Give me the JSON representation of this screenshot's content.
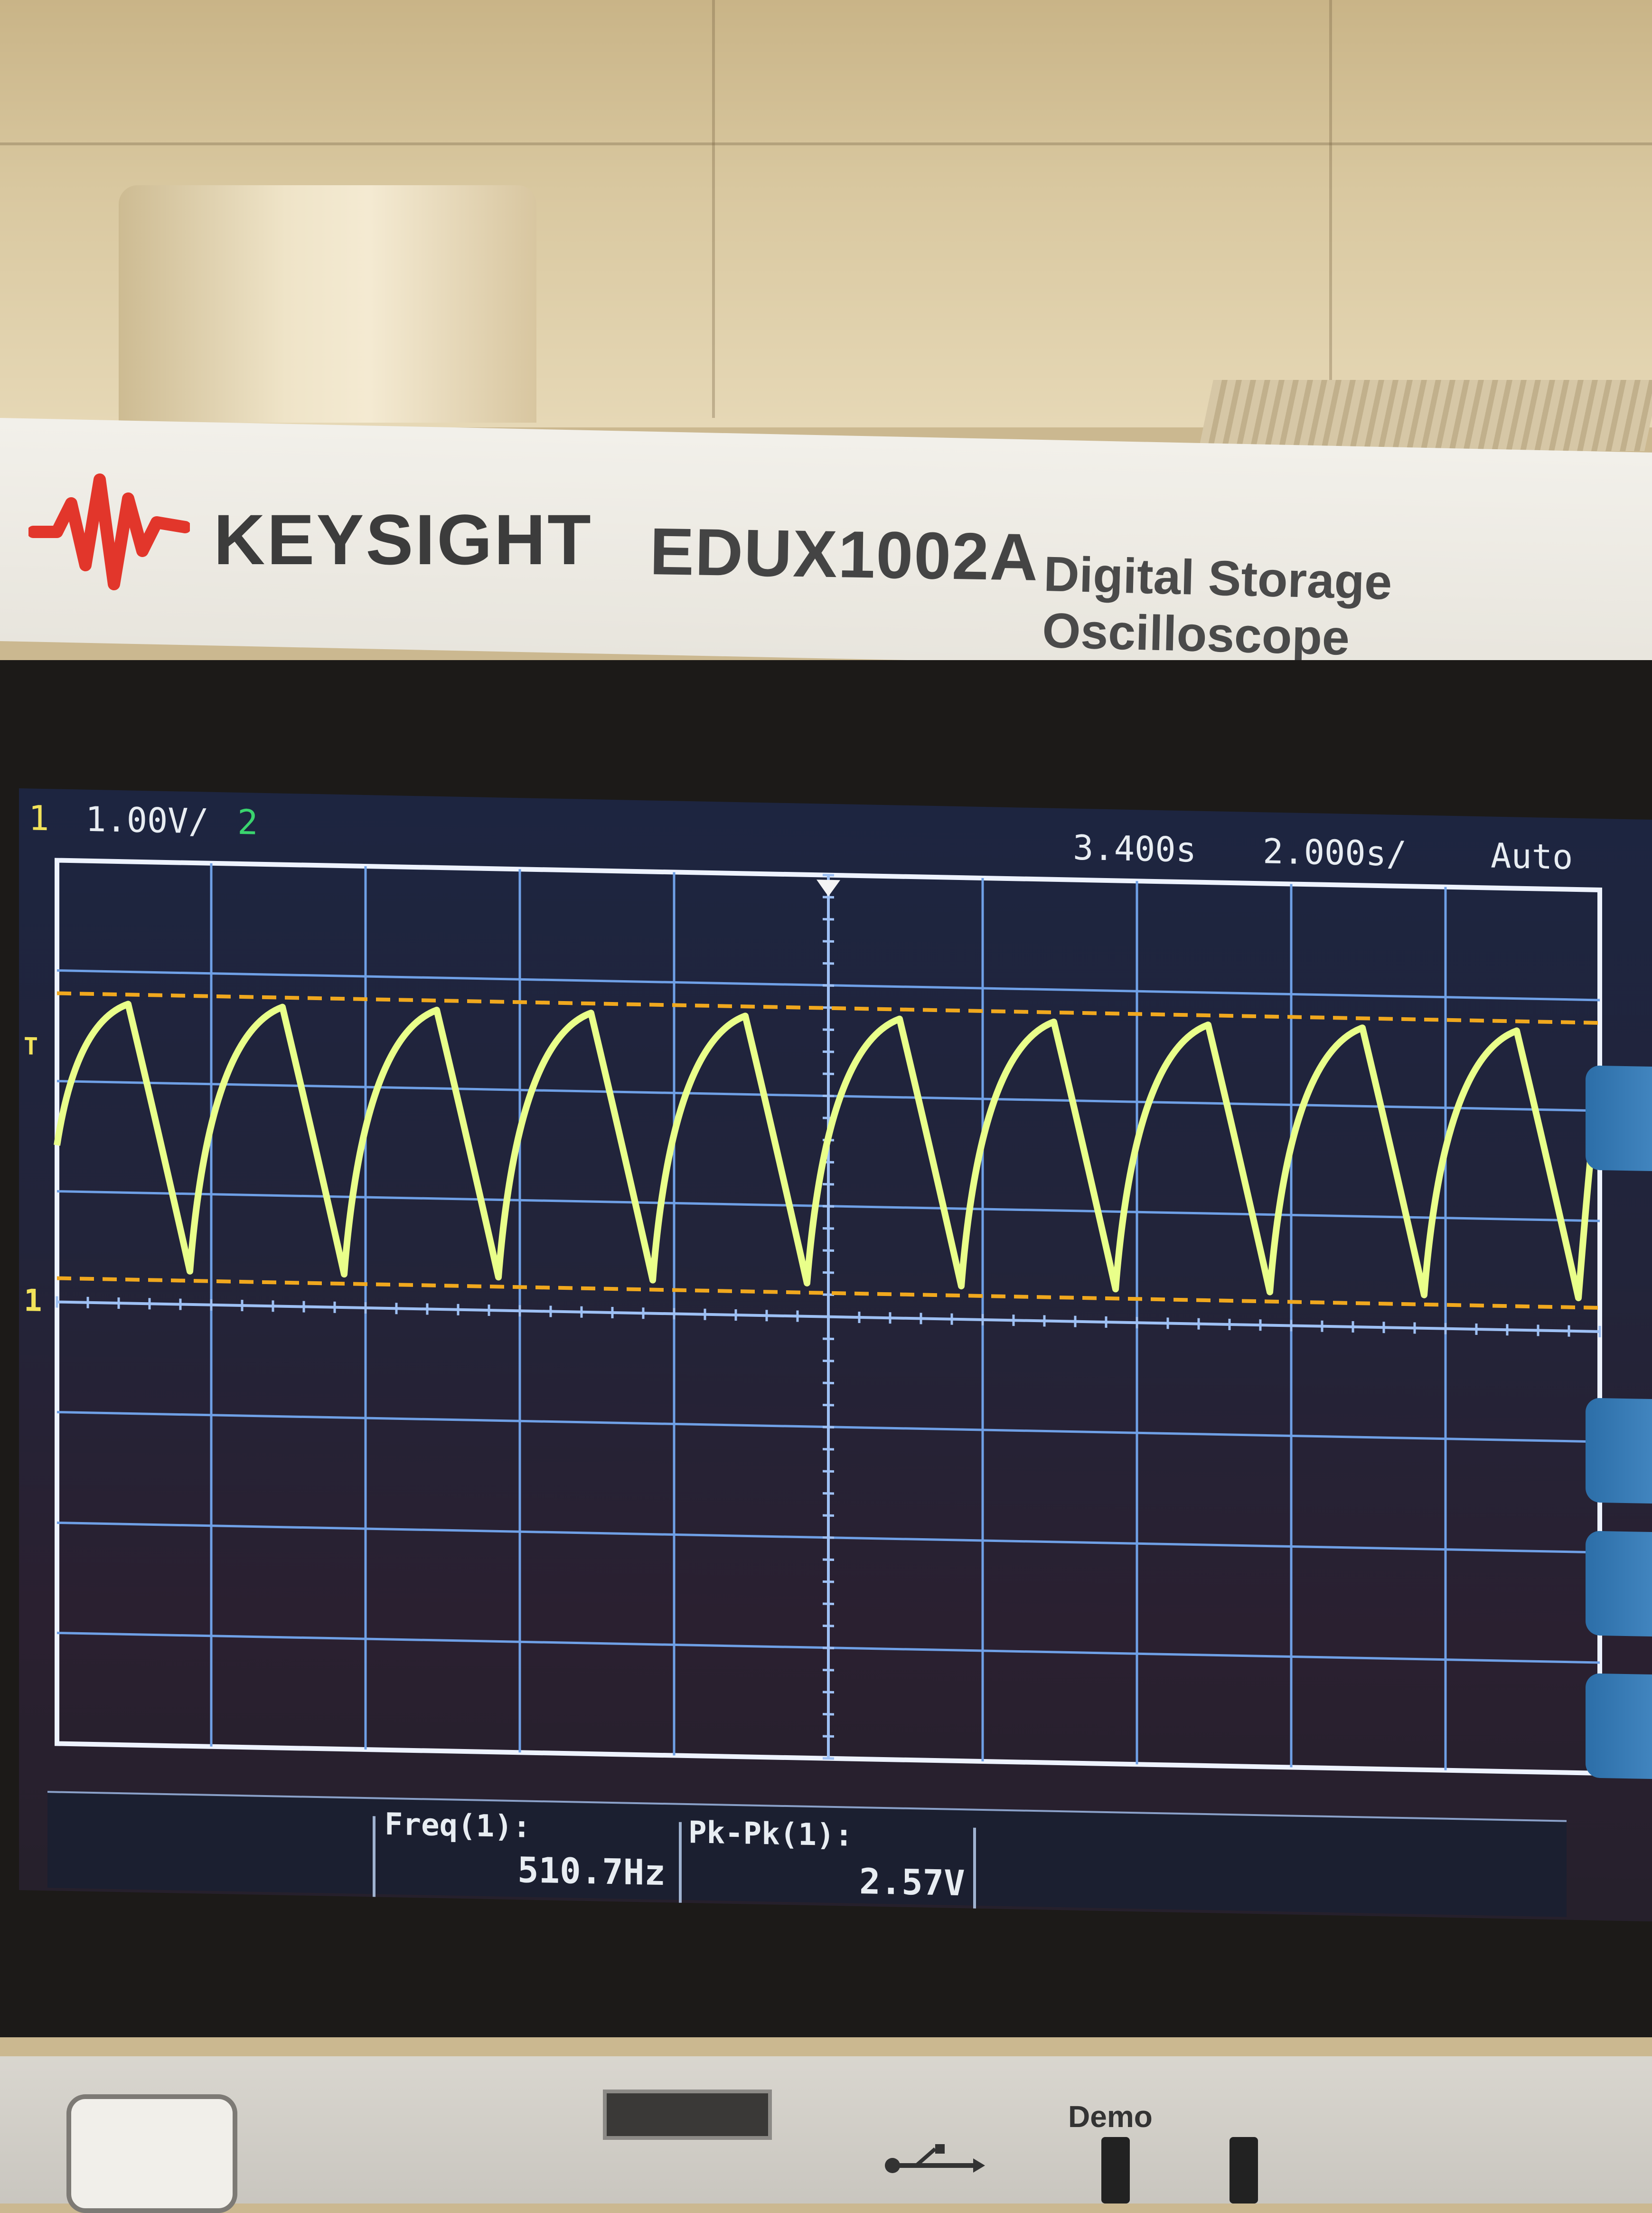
{
  "device": {
    "brand": "KEYSIGHT",
    "model": "EDUX1002A",
    "description": "Digital Storage Oscilloscope"
  },
  "status_bar": {
    "ch1_label": "1",
    "ch1_scale": "1.00V/",
    "ch2_label": "2",
    "trigger_delay": "3.400s",
    "timebase": "2.000s/",
    "trigger_mode": "Auto"
  },
  "measurements": [
    {
      "label": "Freq(1):",
      "value": "510.7Hz"
    },
    {
      "label": "Pk-Pk(1):",
      "value": "2.57V"
    }
  ],
  "panel": {
    "demo_label": "Demo"
  },
  "colors": {
    "trace": "#e9ff8a",
    "cursor_line": "#f0a81e",
    "grid": "#6fa0e6",
    "ch1": "#f2e35a",
    "ch2": "#3ad46e",
    "brand_red": "#e2362b"
  }
}
